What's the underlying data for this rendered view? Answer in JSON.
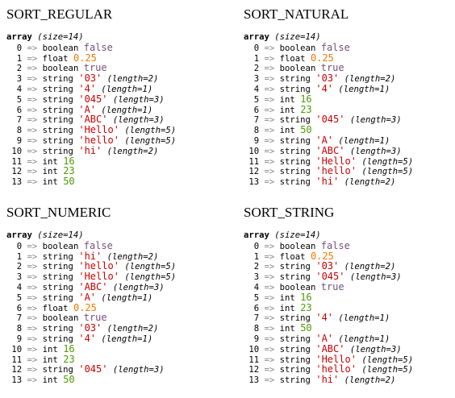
{
  "panels": [
    {
      "title": "SORT_REGULAR",
      "array_label": "array",
      "size_text": "(size=14)",
      "items": [
        {
          "key": "0",
          "type": "boolean",
          "value": "false",
          "vclass": "v-bool",
          "len": ""
        },
        {
          "key": "1",
          "type": "float",
          "value": "0.25",
          "vclass": "v-float",
          "len": ""
        },
        {
          "key": "2",
          "type": "boolean",
          "value": "true",
          "vclass": "v-bool",
          "len": ""
        },
        {
          "key": "3",
          "type": "string",
          "value": "'03'",
          "vclass": "v-str",
          "len": "(length=2)"
        },
        {
          "key": "4",
          "type": "string",
          "value": "'4'",
          "vclass": "v-str",
          "len": "(length=1)"
        },
        {
          "key": "5",
          "type": "string",
          "value": "'045'",
          "vclass": "v-str",
          "len": "(length=3)"
        },
        {
          "key": "6",
          "type": "string",
          "value": "'A'",
          "vclass": "v-str",
          "len": "(length=1)"
        },
        {
          "key": "7",
          "type": "string",
          "value": "'ABC'",
          "vclass": "v-str",
          "len": "(length=3)"
        },
        {
          "key": "8",
          "type": "string",
          "value": "'Hello'",
          "vclass": "v-str",
          "len": "(length=5)"
        },
        {
          "key": "9",
          "type": "string",
          "value": "'hello'",
          "vclass": "v-str",
          "len": "(length=5)"
        },
        {
          "key": "10",
          "type": "string",
          "value": "'hi'",
          "vclass": "v-str",
          "len": "(length=2)"
        },
        {
          "key": "11",
          "type": "int",
          "value": "16",
          "vclass": "v-int",
          "len": ""
        },
        {
          "key": "12",
          "type": "int",
          "value": "23",
          "vclass": "v-int",
          "len": ""
        },
        {
          "key": "13",
          "type": "int",
          "value": "50",
          "vclass": "v-int",
          "len": ""
        }
      ]
    },
    {
      "title": "SORT_NATURAL",
      "array_label": "array",
      "size_text": "(size=14)",
      "items": [
        {
          "key": "0",
          "type": "boolean",
          "value": "false",
          "vclass": "v-bool",
          "len": ""
        },
        {
          "key": "1",
          "type": "float",
          "value": "0.25",
          "vclass": "v-float",
          "len": ""
        },
        {
          "key": "2",
          "type": "boolean",
          "value": "true",
          "vclass": "v-bool",
          "len": ""
        },
        {
          "key": "3",
          "type": "string",
          "value": "'03'",
          "vclass": "v-str",
          "len": "(length=2)"
        },
        {
          "key": "4",
          "type": "string",
          "value": "'4'",
          "vclass": "v-str",
          "len": "(length=1)"
        },
        {
          "key": "5",
          "type": "int",
          "value": "16",
          "vclass": "v-int",
          "len": ""
        },
        {
          "key": "6",
          "type": "int",
          "value": "23",
          "vclass": "v-int",
          "len": ""
        },
        {
          "key": "7",
          "type": "string",
          "value": "'045'",
          "vclass": "v-str",
          "len": "(length=3)"
        },
        {
          "key": "8",
          "type": "int",
          "value": "50",
          "vclass": "v-int",
          "len": ""
        },
        {
          "key": "9",
          "type": "string",
          "value": "'A'",
          "vclass": "v-str",
          "len": "(length=1)"
        },
        {
          "key": "10",
          "type": "string",
          "value": "'ABC'",
          "vclass": "v-str",
          "len": "(length=3)"
        },
        {
          "key": "11",
          "type": "string",
          "value": "'Hello'",
          "vclass": "v-str",
          "len": "(length=5)"
        },
        {
          "key": "12",
          "type": "string",
          "value": "'hello'",
          "vclass": "v-str",
          "len": "(length=5)"
        },
        {
          "key": "13",
          "type": "string",
          "value": "'hi'",
          "vclass": "v-str",
          "len": "(length=2)"
        }
      ]
    },
    {
      "title": "SORT_NUMERIC",
      "array_label": "array",
      "size_text": "(size=14)",
      "items": [
        {
          "key": "0",
          "type": "boolean",
          "value": "false",
          "vclass": "v-bool",
          "len": ""
        },
        {
          "key": "1",
          "type": "string",
          "value": "'hi'",
          "vclass": "v-str",
          "len": "(length=2)"
        },
        {
          "key": "2",
          "type": "string",
          "value": "'hello'",
          "vclass": "v-str",
          "len": "(length=5)"
        },
        {
          "key": "3",
          "type": "string",
          "value": "'Hello'",
          "vclass": "v-str",
          "len": "(length=5)"
        },
        {
          "key": "4",
          "type": "string",
          "value": "'ABC'",
          "vclass": "v-str",
          "len": "(length=3)"
        },
        {
          "key": "5",
          "type": "string",
          "value": "'A'",
          "vclass": "v-str",
          "len": "(length=1)"
        },
        {
          "key": "6",
          "type": "float",
          "value": "0.25",
          "vclass": "v-float",
          "len": ""
        },
        {
          "key": "7",
          "type": "boolean",
          "value": "true",
          "vclass": "v-bool",
          "len": ""
        },
        {
          "key": "8",
          "type": "string",
          "value": "'03'",
          "vclass": "v-str",
          "len": "(length=2)"
        },
        {
          "key": "9",
          "type": "string",
          "value": "'4'",
          "vclass": "v-str",
          "len": "(length=1)"
        },
        {
          "key": "10",
          "type": "int",
          "value": "16",
          "vclass": "v-int",
          "len": ""
        },
        {
          "key": "11",
          "type": "int",
          "value": "23",
          "vclass": "v-int",
          "len": ""
        },
        {
          "key": "12",
          "type": "string",
          "value": "'045'",
          "vclass": "v-str",
          "len": "(length=3)"
        },
        {
          "key": "13",
          "type": "int",
          "value": "50",
          "vclass": "v-int",
          "len": ""
        }
      ]
    },
    {
      "title": "SORT_STRING",
      "array_label": "array",
      "size_text": "(size=14)",
      "items": [
        {
          "key": "0",
          "type": "boolean",
          "value": "false",
          "vclass": "v-bool",
          "len": ""
        },
        {
          "key": "1",
          "type": "float",
          "value": "0.25",
          "vclass": "v-float",
          "len": ""
        },
        {
          "key": "2",
          "type": "string",
          "value": "'03'",
          "vclass": "v-str",
          "len": "(length=2)"
        },
        {
          "key": "3",
          "type": "string",
          "value": "'045'",
          "vclass": "v-str",
          "len": "(length=3)"
        },
        {
          "key": "4",
          "type": "boolean",
          "value": "true",
          "vclass": "v-bool",
          "len": ""
        },
        {
          "key": "5",
          "type": "int",
          "value": "16",
          "vclass": "v-int",
          "len": ""
        },
        {
          "key": "6",
          "type": "int",
          "value": "23",
          "vclass": "v-int",
          "len": ""
        },
        {
          "key": "7",
          "type": "string",
          "value": "'4'",
          "vclass": "v-str",
          "len": "(length=1)"
        },
        {
          "key": "8",
          "type": "int",
          "value": "50",
          "vclass": "v-int",
          "len": ""
        },
        {
          "key": "9",
          "type": "string",
          "value": "'A'",
          "vclass": "v-str",
          "len": "(length=1)"
        },
        {
          "key": "10",
          "type": "string",
          "value": "'ABC'",
          "vclass": "v-str",
          "len": "(length=3)"
        },
        {
          "key": "11",
          "type": "string",
          "value": "'Hello'",
          "vclass": "v-str",
          "len": "(length=5)"
        },
        {
          "key": "12",
          "type": "string",
          "value": "'hello'",
          "vclass": "v-str",
          "len": "(length=5)"
        },
        {
          "key": "13",
          "type": "string",
          "value": "'hi'",
          "vclass": "v-str",
          "len": "(length=2)"
        }
      ]
    }
  ],
  "colors": {
    "boolean": "#75507b",
    "float": "#f57900",
    "int": "#4e9a06",
    "string": "#cc0000",
    "arrow": "#888a85"
  }
}
